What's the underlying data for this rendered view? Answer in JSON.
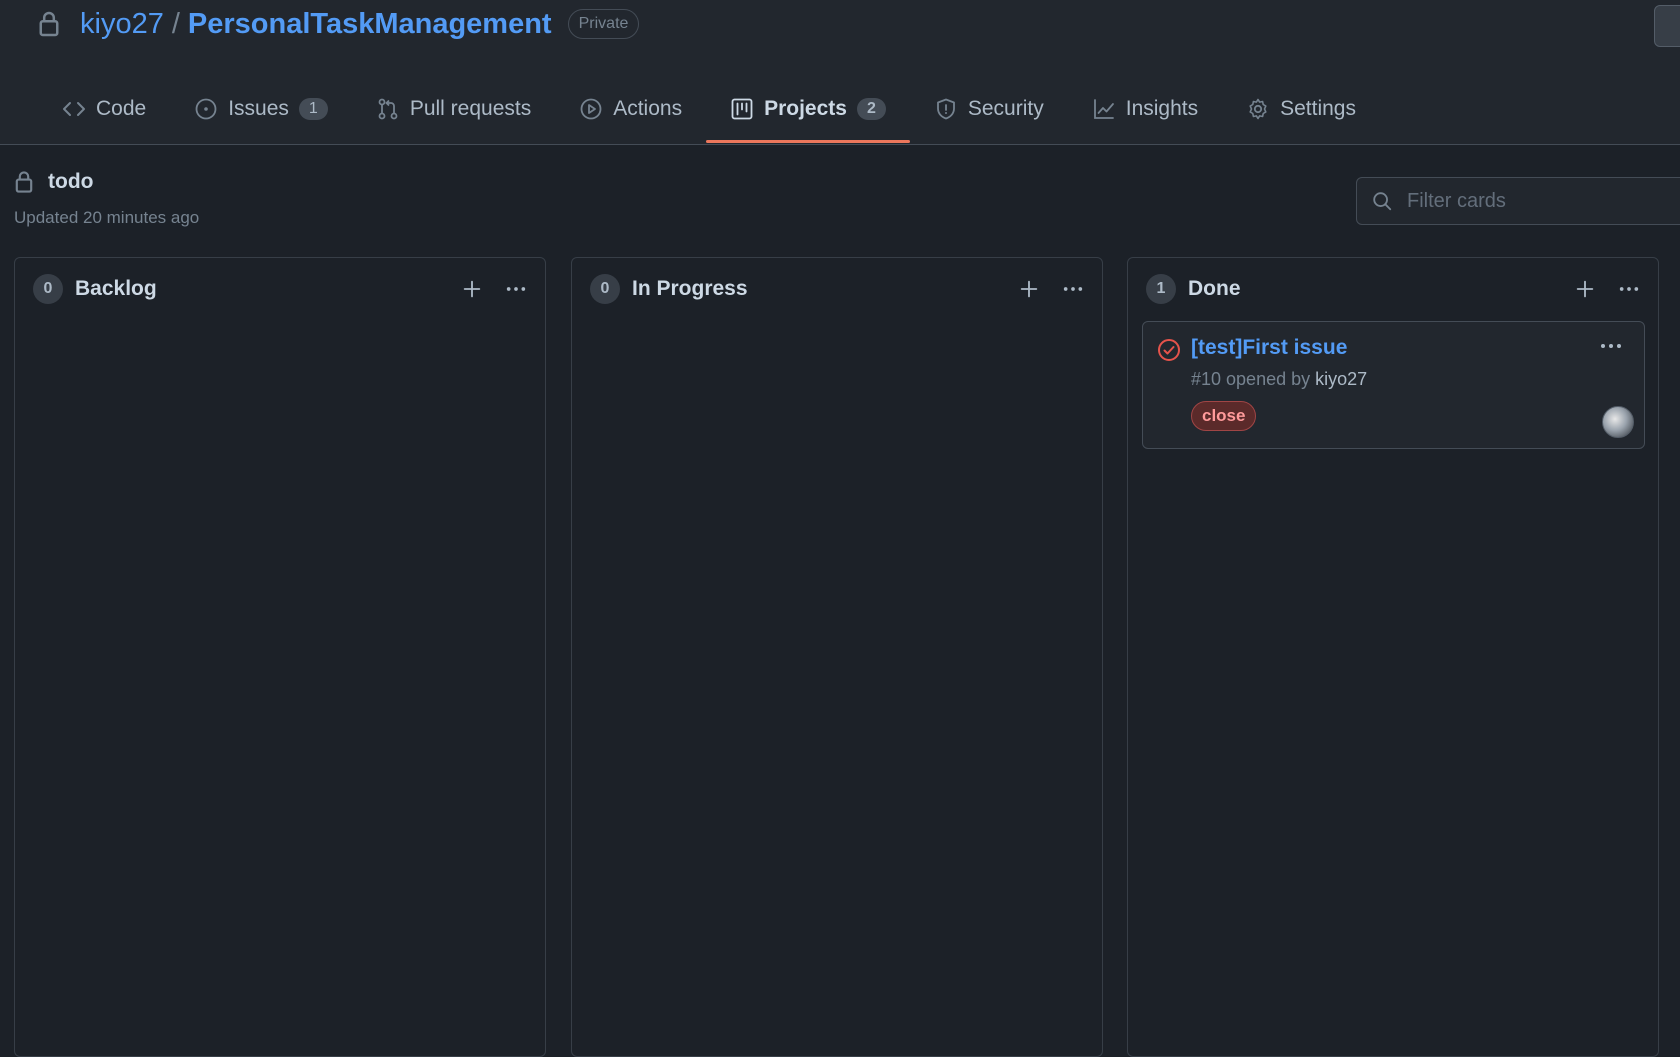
{
  "repo": {
    "owner": "kiyo27",
    "separator": "/",
    "name": "PersonalTaskManagement",
    "visibility": "Private"
  },
  "tabs": [
    {
      "label": "Code",
      "icon": "code-icon"
    },
    {
      "label": "Issues",
      "icon": "issue-opened-icon",
      "count": "1"
    },
    {
      "label": "Pull requests",
      "icon": "git-pull-request-icon"
    },
    {
      "label": "Actions",
      "icon": "play-icon"
    },
    {
      "label": "Projects",
      "icon": "project-icon",
      "count": "2",
      "active": true
    },
    {
      "label": "Security",
      "icon": "shield-icon"
    },
    {
      "label": "Insights",
      "icon": "graph-icon"
    },
    {
      "label": "Settings",
      "icon": "gear-icon"
    }
  ],
  "project": {
    "name": "todo",
    "updated": "Updated 20 minutes ago"
  },
  "filter": {
    "placeholder": "Filter cards"
  },
  "columns": [
    {
      "title": "Backlog",
      "count": "0"
    },
    {
      "title": "In Progress",
      "count": "0"
    },
    {
      "title": "Done",
      "count": "1"
    }
  ],
  "card": {
    "title": "[test]First issue",
    "meta_prefix": "#10 opened by",
    "author": "kiyo27",
    "label": "close"
  },
  "colors": {
    "background": "#1c2128",
    "header": "#22272e",
    "link": "#539bf5",
    "active_tab_underline": "#ec775c",
    "closed_issue": "#e5534b"
  }
}
